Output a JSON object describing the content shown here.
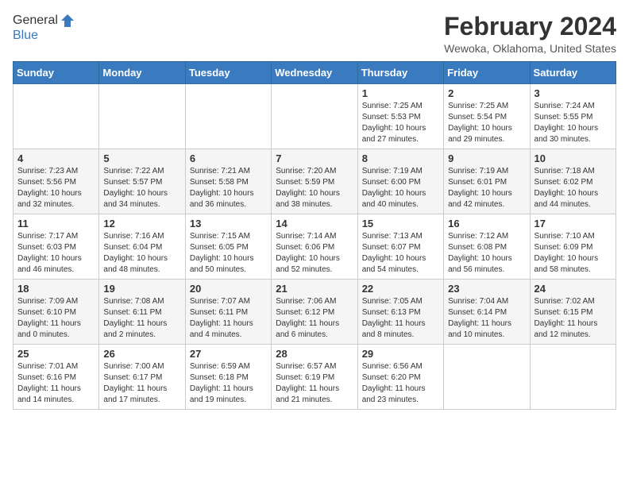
{
  "header": {
    "logo_general": "General",
    "logo_blue": "Blue",
    "month_title": "February 2024",
    "location": "Wewoka, Oklahoma, United States"
  },
  "weekdays": [
    "Sunday",
    "Monday",
    "Tuesday",
    "Wednesday",
    "Thursday",
    "Friday",
    "Saturday"
  ],
  "weeks": [
    [
      {
        "day": "",
        "sunrise": "",
        "sunset": "",
        "daylight": ""
      },
      {
        "day": "",
        "sunrise": "",
        "sunset": "",
        "daylight": ""
      },
      {
        "day": "",
        "sunrise": "",
        "sunset": "",
        "daylight": ""
      },
      {
        "day": "",
        "sunrise": "",
        "sunset": "",
        "daylight": ""
      },
      {
        "day": "1",
        "sunrise": "Sunrise: 7:25 AM",
        "sunset": "Sunset: 5:53 PM",
        "daylight": "Daylight: 10 hours and 27 minutes."
      },
      {
        "day": "2",
        "sunrise": "Sunrise: 7:25 AM",
        "sunset": "Sunset: 5:54 PM",
        "daylight": "Daylight: 10 hours and 29 minutes."
      },
      {
        "day": "3",
        "sunrise": "Sunrise: 7:24 AM",
        "sunset": "Sunset: 5:55 PM",
        "daylight": "Daylight: 10 hours and 30 minutes."
      }
    ],
    [
      {
        "day": "4",
        "sunrise": "Sunrise: 7:23 AM",
        "sunset": "Sunset: 5:56 PM",
        "daylight": "Daylight: 10 hours and 32 minutes."
      },
      {
        "day": "5",
        "sunrise": "Sunrise: 7:22 AM",
        "sunset": "Sunset: 5:57 PM",
        "daylight": "Daylight: 10 hours and 34 minutes."
      },
      {
        "day": "6",
        "sunrise": "Sunrise: 7:21 AM",
        "sunset": "Sunset: 5:58 PM",
        "daylight": "Daylight: 10 hours and 36 minutes."
      },
      {
        "day": "7",
        "sunrise": "Sunrise: 7:20 AM",
        "sunset": "Sunset: 5:59 PM",
        "daylight": "Daylight: 10 hours and 38 minutes."
      },
      {
        "day": "8",
        "sunrise": "Sunrise: 7:19 AM",
        "sunset": "Sunset: 6:00 PM",
        "daylight": "Daylight: 10 hours and 40 minutes."
      },
      {
        "day": "9",
        "sunrise": "Sunrise: 7:19 AM",
        "sunset": "Sunset: 6:01 PM",
        "daylight": "Daylight: 10 hours and 42 minutes."
      },
      {
        "day": "10",
        "sunrise": "Sunrise: 7:18 AM",
        "sunset": "Sunset: 6:02 PM",
        "daylight": "Daylight: 10 hours and 44 minutes."
      }
    ],
    [
      {
        "day": "11",
        "sunrise": "Sunrise: 7:17 AM",
        "sunset": "Sunset: 6:03 PM",
        "daylight": "Daylight: 10 hours and 46 minutes."
      },
      {
        "day": "12",
        "sunrise": "Sunrise: 7:16 AM",
        "sunset": "Sunset: 6:04 PM",
        "daylight": "Daylight: 10 hours and 48 minutes."
      },
      {
        "day": "13",
        "sunrise": "Sunrise: 7:15 AM",
        "sunset": "Sunset: 6:05 PM",
        "daylight": "Daylight: 10 hours and 50 minutes."
      },
      {
        "day": "14",
        "sunrise": "Sunrise: 7:14 AM",
        "sunset": "Sunset: 6:06 PM",
        "daylight": "Daylight: 10 hours and 52 minutes."
      },
      {
        "day": "15",
        "sunrise": "Sunrise: 7:13 AM",
        "sunset": "Sunset: 6:07 PM",
        "daylight": "Daylight: 10 hours and 54 minutes."
      },
      {
        "day": "16",
        "sunrise": "Sunrise: 7:12 AM",
        "sunset": "Sunset: 6:08 PM",
        "daylight": "Daylight: 10 hours and 56 minutes."
      },
      {
        "day": "17",
        "sunrise": "Sunrise: 7:10 AM",
        "sunset": "Sunset: 6:09 PM",
        "daylight": "Daylight: 10 hours and 58 minutes."
      }
    ],
    [
      {
        "day": "18",
        "sunrise": "Sunrise: 7:09 AM",
        "sunset": "Sunset: 6:10 PM",
        "daylight": "Daylight: 11 hours and 0 minutes."
      },
      {
        "day": "19",
        "sunrise": "Sunrise: 7:08 AM",
        "sunset": "Sunset: 6:11 PM",
        "daylight": "Daylight: 11 hours and 2 minutes."
      },
      {
        "day": "20",
        "sunrise": "Sunrise: 7:07 AM",
        "sunset": "Sunset: 6:11 PM",
        "daylight": "Daylight: 11 hours and 4 minutes."
      },
      {
        "day": "21",
        "sunrise": "Sunrise: 7:06 AM",
        "sunset": "Sunset: 6:12 PM",
        "daylight": "Daylight: 11 hours and 6 minutes."
      },
      {
        "day": "22",
        "sunrise": "Sunrise: 7:05 AM",
        "sunset": "Sunset: 6:13 PM",
        "daylight": "Daylight: 11 hours and 8 minutes."
      },
      {
        "day": "23",
        "sunrise": "Sunrise: 7:04 AM",
        "sunset": "Sunset: 6:14 PM",
        "daylight": "Daylight: 11 hours and 10 minutes."
      },
      {
        "day": "24",
        "sunrise": "Sunrise: 7:02 AM",
        "sunset": "Sunset: 6:15 PM",
        "daylight": "Daylight: 11 hours and 12 minutes."
      }
    ],
    [
      {
        "day": "25",
        "sunrise": "Sunrise: 7:01 AM",
        "sunset": "Sunset: 6:16 PM",
        "daylight": "Daylight: 11 hours and 14 minutes."
      },
      {
        "day": "26",
        "sunrise": "Sunrise: 7:00 AM",
        "sunset": "Sunset: 6:17 PM",
        "daylight": "Daylight: 11 hours and 17 minutes."
      },
      {
        "day": "27",
        "sunrise": "Sunrise: 6:59 AM",
        "sunset": "Sunset: 6:18 PM",
        "daylight": "Daylight: 11 hours and 19 minutes."
      },
      {
        "day": "28",
        "sunrise": "Sunrise: 6:57 AM",
        "sunset": "Sunset: 6:19 PM",
        "daylight": "Daylight: 11 hours and 21 minutes."
      },
      {
        "day": "29",
        "sunrise": "Sunrise: 6:56 AM",
        "sunset": "Sunset: 6:20 PM",
        "daylight": "Daylight: 11 hours and 23 minutes."
      },
      {
        "day": "",
        "sunrise": "",
        "sunset": "",
        "daylight": ""
      },
      {
        "day": "",
        "sunrise": "",
        "sunset": "",
        "daylight": ""
      }
    ]
  ]
}
